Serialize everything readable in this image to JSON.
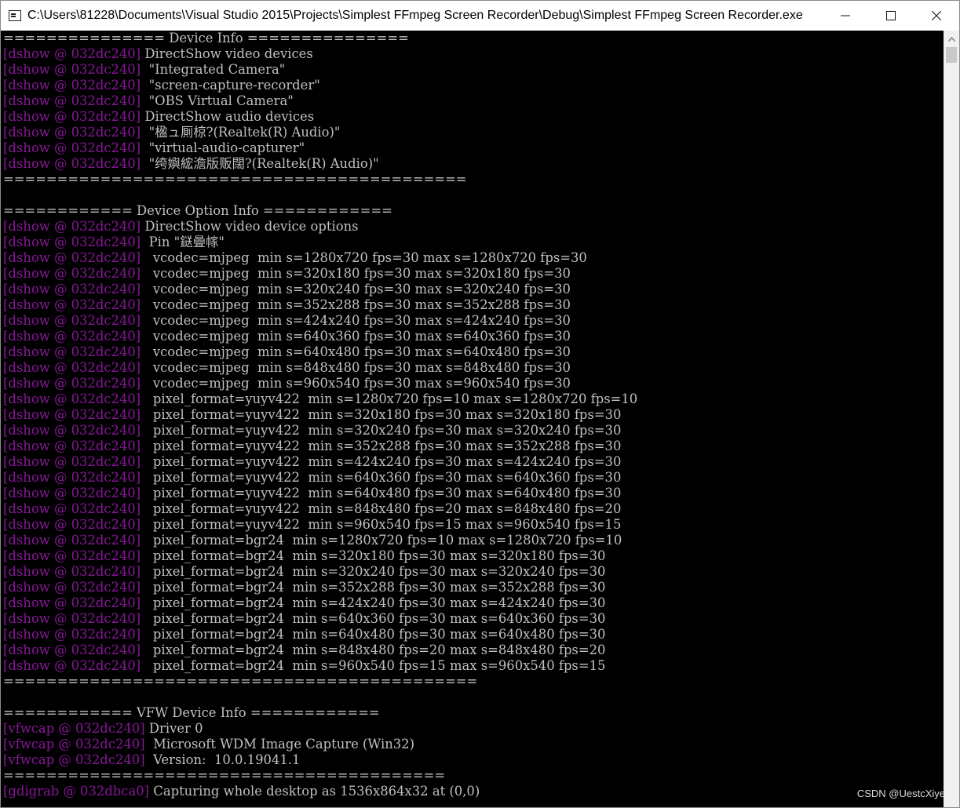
{
  "window": {
    "title": "C:\\Users\\81228\\Documents\\Visual Studio 2015\\Projects\\Simplest FFmpeg Screen Recorder\\Debug\\Simplest FFmpeg Screen Recorder.exe",
    "icon": "console-app-icon",
    "buttons": [
      "minimize-icon",
      "maximize-icon",
      "close-icon"
    ]
  },
  "colors": {
    "background": "#000000",
    "text": "#c0c0c0",
    "tag": "#881798"
  },
  "console": {
    "lines": [
      {
        "tag": "",
        "text": "=============== Device Info ==============="
      },
      {
        "tag": "[dshow @ 032dc240]",
        "text": " DirectShow video devices"
      },
      {
        "tag": "[dshow @ 032dc240]",
        "text": "  \"Integrated Camera\""
      },
      {
        "tag": "[dshow @ 032dc240]",
        "text": "  \"screen-capture-recorder\""
      },
      {
        "tag": "[dshow @ 032dc240]",
        "text": "  \"OBS Virtual Camera\""
      },
      {
        "tag": "[dshow @ 032dc240]",
        "text": " DirectShow audio devices"
      },
      {
        "tag": "[dshow @ 032dc240]",
        "text": "  \"楹ュ厠椋?(Realtek(R) Audio)\""
      },
      {
        "tag": "[dshow @ 032dc240]",
        "text": "  \"virtual-audio-capturer\""
      },
      {
        "tag": "[dshow @ 032dc240]",
        "text": "  \"绔嬩綋澹版贩闊?(Realtek(R) Audio)\""
      },
      {
        "tag": "",
        "text": "==========================================="
      },
      {
        "tag": "",
        "text": ""
      },
      {
        "tag": "",
        "text": "============ Device Option Info ============"
      },
      {
        "tag": "[dshow @ 032dc240]",
        "text": " DirectShow video device options"
      },
      {
        "tag": "[dshow @ 032dc240]",
        "text": "  Pin \"鎹曡幏\""
      },
      {
        "tag": "[dshow @ 032dc240]",
        "text": "   vcodec=mjpeg  min s=1280x720 fps=30 max s=1280x720 fps=30"
      },
      {
        "tag": "[dshow @ 032dc240]",
        "text": "   vcodec=mjpeg  min s=320x180 fps=30 max s=320x180 fps=30"
      },
      {
        "tag": "[dshow @ 032dc240]",
        "text": "   vcodec=mjpeg  min s=320x240 fps=30 max s=320x240 fps=30"
      },
      {
        "tag": "[dshow @ 032dc240]",
        "text": "   vcodec=mjpeg  min s=352x288 fps=30 max s=352x288 fps=30"
      },
      {
        "tag": "[dshow @ 032dc240]",
        "text": "   vcodec=mjpeg  min s=424x240 fps=30 max s=424x240 fps=30"
      },
      {
        "tag": "[dshow @ 032dc240]",
        "text": "   vcodec=mjpeg  min s=640x360 fps=30 max s=640x360 fps=30"
      },
      {
        "tag": "[dshow @ 032dc240]",
        "text": "   vcodec=mjpeg  min s=640x480 fps=30 max s=640x480 fps=30"
      },
      {
        "tag": "[dshow @ 032dc240]",
        "text": "   vcodec=mjpeg  min s=848x480 fps=30 max s=848x480 fps=30"
      },
      {
        "tag": "[dshow @ 032dc240]",
        "text": "   vcodec=mjpeg  min s=960x540 fps=30 max s=960x540 fps=30"
      },
      {
        "tag": "[dshow @ 032dc240]",
        "text": "   pixel_format=yuyv422  min s=1280x720 fps=10 max s=1280x720 fps=10"
      },
      {
        "tag": "[dshow @ 032dc240]",
        "text": "   pixel_format=yuyv422  min s=320x180 fps=30 max s=320x180 fps=30"
      },
      {
        "tag": "[dshow @ 032dc240]",
        "text": "   pixel_format=yuyv422  min s=320x240 fps=30 max s=320x240 fps=30"
      },
      {
        "tag": "[dshow @ 032dc240]",
        "text": "   pixel_format=yuyv422  min s=352x288 fps=30 max s=352x288 fps=30"
      },
      {
        "tag": "[dshow @ 032dc240]",
        "text": "   pixel_format=yuyv422  min s=424x240 fps=30 max s=424x240 fps=30"
      },
      {
        "tag": "[dshow @ 032dc240]",
        "text": "   pixel_format=yuyv422  min s=640x360 fps=30 max s=640x360 fps=30"
      },
      {
        "tag": "[dshow @ 032dc240]",
        "text": "   pixel_format=yuyv422  min s=640x480 fps=30 max s=640x480 fps=30"
      },
      {
        "tag": "[dshow @ 032dc240]",
        "text": "   pixel_format=yuyv422  min s=848x480 fps=20 max s=848x480 fps=20"
      },
      {
        "tag": "[dshow @ 032dc240]",
        "text": "   pixel_format=yuyv422  min s=960x540 fps=15 max s=960x540 fps=15"
      },
      {
        "tag": "[dshow @ 032dc240]",
        "text": "   pixel_format=bgr24  min s=1280x720 fps=10 max s=1280x720 fps=10"
      },
      {
        "tag": "[dshow @ 032dc240]",
        "text": "   pixel_format=bgr24  min s=320x180 fps=30 max s=320x180 fps=30"
      },
      {
        "tag": "[dshow @ 032dc240]",
        "text": "   pixel_format=bgr24  min s=320x240 fps=30 max s=320x240 fps=30"
      },
      {
        "tag": "[dshow @ 032dc240]",
        "text": "   pixel_format=bgr24  min s=352x288 fps=30 max s=352x288 fps=30"
      },
      {
        "tag": "[dshow @ 032dc240]",
        "text": "   pixel_format=bgr24  min s=424x240 fps=30 max s=424x240 fps=30"
      },
      {
        "tag": "[dshow @ 032dc240]",
        "text": "   pixel_format=bgr24  min s=640x360 fps=30 max s=640x360 fps=30"
      },
      {
        "tag": "[dshow @ 032dc240]",
        "text": "   pixel_format=bgr24  min s=640x480 fps=30 max s=640x480 fps=30"
      },
      {
        "tag": "[dshow @ 032dc240]",
        "text": "   pixel_format=bgr24  min s=848x480 fps=20 max s=848x480 fps=20"
      },
      {
        "tag": "[dshow @ 032dc240]",
        "text": "   pixel_format=bgr24  min s=960x540 fps=15 max s=960x540 fps=15"
      },
      {
        "tag": "",
        "text": "============================================"
      },
      {
        "tag": "",
        "text": ""
      },
      {
        "tag": "",
        "text": "============ VFW Device Info ============"
      },
      {
        "tag": "[vfwcap @ 032dc240]",
        "text": " Driver 0"
      },
      {
        "tag": "[vfwcap @ 032dc240]",
        "text": "  Microsoft WDM Image Capture (Win32)"
      },
      {
        "tag": "[vfwcap @ 032dc240]",
        "text": "  Version:  10.0.19041.1"
      },
      {
        "tag": "",
        "text": "========================================="
      },
      {
        "tag": "[gdigrab @ 032dbca0]",
        "text": " Capturing whole desktop as 1536x864x32 at (0,0)"
      }
    ]
  },
  "watermark": "CSDN @UestcXiye"
}
